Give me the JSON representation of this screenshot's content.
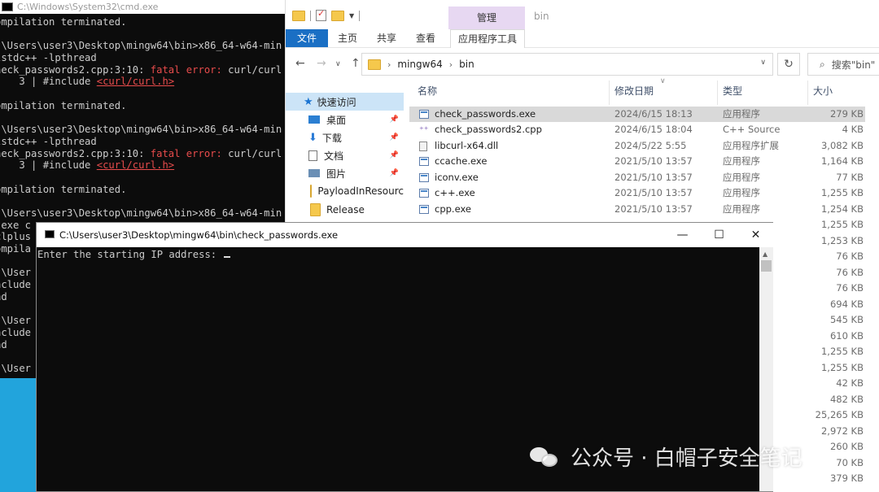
{
  "cmd_window": {
    "title": "C:\\Windows\\System32\\cmd.exe",
    "lines": [
      [
        {
          "t": "ompilation terminated."
        }
      ],
      [
        {
          "t": ""
        }
      ],
      [
        {
          "t": ":\\Users\\user3\\Desktop\\mingw64\\bin>x86_64-w64-min"
        }
      ],
      [
        {
          "t": "lstdc++ -lpthread"
        }
      ],
      [
        {
          "t": "heck_passwords2.cpp:3:10: "
        },
        {
          "t": "fatal error: ",
          "c": "red"
        },
        {
          "t": "curl/curl"
        }
      ],
      [
        {
          "t": "    3 | #include "
        },
        {
          "t": "<curl/curl.h>",
          "c": "ul"
        }
      ],
      [
        {
          "t": ""
        }
      ],
      [
        {
          "t": "ompilation terminated."
        }
      ],
      [
        {
          "t": ""
        }
      ],
      [
        {
          "t": ":\\Users\\user3\\Desktop\\mingw64\\bin>x86_64-w64-min"
        }
      ],
      [
        {
          "t": "lstdc++ -lpthread"
        }
      ],
      [
        {
          "t": "heck_passwords2.cpp:3:10: "
        },
        {
          "t": "fatal error: ",
          "c": "red"
        },
        {
          "t": "curl/curl"
        }
      ],
      [
        {
          "t": "    3 | #include "
        },
        {
          "t": "<curl/curl.h>",
          "c": "ul"
        }
      ],
      [
        {
          "t": ""
        }
      ],
      [
        {
          "t": "ompilation terminated."
        }
      ],
      [
        {
          "t": ""
        }
      ],
      [
        {
          "t": ":\\Users\\user3\\Desktop\\mingw64\\bin>x86_64-w64-min"
        }
      ],
      [
        {
          "t": ".exe c"
        }
      ],
      [
        {
          "t": "clplus"
        }
      ],
      [
        {
          "t": "ompila"
        }
      ],
      [
        {
          "t": ""
        }
      ],
      [
        {
          "t": ":\\User"
        }
      ],
      [
        {
          "t": "nclude"
        }
      ],
      [
        {
          "t": "ad"
        }
      ],
      [
        {
          "t": ""
        }
      ],
      [
        {
          "t": ":\\User"
        }
      ],
      [
        {
          "t": "nclude"
        }
      ],
      [
        {
          "t": "ad"
        }
      ],
      [
        {
          "t": ""
        }
      ],
      [
        {
          "t": ":\\User"
        }
      ]
    ]
  },
  "explorer": {
    "window_name": "bin",
    "manage_tab": "管理",
    "ribbon_tabs": [
      "文件",
      "主页",
      "共享",
      "查看",
      "应用程序工具"
    ],
    "breadcrumb": [
      "mingw64",
      "bin"
    ],
    "search_placeholder": "搜索\"bin\"",
    "nav_items": [
      {
        "label": "快速访问",
        "icon": "star-icon",
        "selected": true,
        "pin": false
      },
      {
        "label": "桌面",
        "icon": "desktop-icon",
        "selected": false,
        "pin": true
      },
      {
        "label": "下载",
        "icon": "download-icon",
        "selected": false,
        "pin": true
      },
      {
        "label": "文档",
        "icon": "document-icon",
        "selected": false,
        "pin": true
      },
      {
        "label": "图片",
        "icon": "pictures-icon",
        "selected": false,
        "pin": true
      },
      {
        "label": "PayloadInResourc",
        "icon": "folder-icon",
        "selected": false,
        "pin": false
      },
      {
        "label": "Release",
        "icon": "folder-icon",
        "selected": false,
        "pin": false
      }
    ],
    "columns": {
      "name": "名称",
      "date": "修改日期",
      "type": "类型",
      "size": "大小"
    },
    "files": [
      {
        "name": "check_passwords.exe",
        "date": "2024/6/15 18:13",
        "type": "应用程序",
        "size": "279 KB",
        "icon": "exe",
        "selected": true
      },
      {
        "name": "check_passwords2.cpp",
        "date": "2024/6/15 18:04",
        "type": "C++ Source",
        "size": "4 KB",
        "icon": "cpp",
        "selected": false
      },
      {
        "name": "libcurl-x64.dll",
        "date": "2024/5/22 5:55",
        "type": "应用程序扩展",
        "size": "3,082 KB",
        "icon": "dll",
        "selected": false
      },
      {
        "name": "ccache.exe",
        "date": "2021/5/10 13:57",
        "type": "应用程序",
        "size": "1,164 KB",
        "icon": "exe",
        "selected": false
      },
      {
        "name": "iconv.exe",
        "date": "2021/5/10 13:57",
        "type": "应用程序",
        "size": "77 KB",
        "icon": "exe",
        "selected": false
      },
      {
        "name": "c++.exe",
        "date": "2021/5/10 13:57",
        "type": "应用程序",
        "size": "1,255 KB",
        "icon": "exe",
        "selected": false
      },
      {
        "name": "cpp.exe",
        "date": "2021/5/10 13:57",
        "type": "应用程序",
        "size": "1,254 KB",
        "icon": "exe",
        "selected": false
      }
    ],
    "hidden_sizes": [
      "1,255 KB",
      "1,253 KB",
      "76 KB",
      "76 KB",
      "76 KB",
      "694 KB",
      "545 KB",
      "610 KB",
      "1,255 KB",
      "1,255 KB",
      "42 KB",
      "482 KB",
      "25,265 KB",
      "2,972 KB",
      "260 KB",
      "70 KB",
      "379 KB"
    ]
  },
  "console": {
    "title": "C:\\Users\\user3\\Desktop\\mingw64\\bin\\check_passwords.exe",
    "prompt": "Enter the starting IP address: "
  },
  "watermark": {
    "text": "公众号 · 白帽子安全笔记"
  },
  "colors": {
    "desktop": "#0a9bd8",
    "file_tab": "#1a6fc4",
    "manage_tab": "#e7d8f2",
    "selection": "#cce4f7",
    "error": "#e84c4c"
  }
}
